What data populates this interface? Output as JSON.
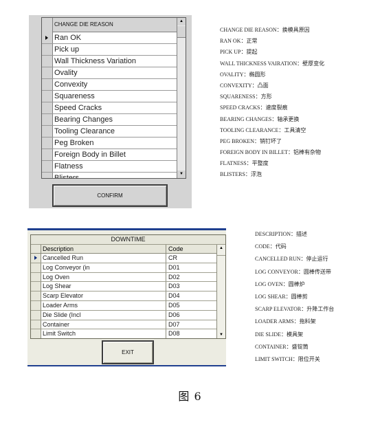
{
  "change_die_panel": {
    "column_header": "CHANGE DIE REASON",
    "selected_index": 0,
    "rows": [
      "Ran OK",
      "Pick up",
      "Wall Thickness Variation",
      "Ovality",
      "Convexity",
      "Squareness",
      "Speed Cracks",
      "Bearing Changes",
      "Tooling Clearance",
      "Peg Broken",
      "Foreign Body in Billet",
      "Flatness",
      "Blisters"
    ],
    "confirm_label": "CONFIRM",
    "scroll_up_icon": "▲",
    "scroll_down_icon": "▼"
  },
  "glossary_1": [
    "CHANGE DIE REASON：换模具原因",
    "RAN OK：正常",
    "PICK UP：提起",
    "WALL THICKNESS VAIRATION：壁厚变化",
    "OVALITY：椭圆形",
    "CONVEXITY：凸面",
    "SQUARENESS：方形",
    "SPEED CRACKS：速度裂痕",
    "BEARING CHANGES：轴承更换",
    "TOOLING CLEARANCE：工具清空",
    "PEG BROKEN：销钉坏了",
    "FOREIGN BODY IN BILLET：铝棒有杂物",
    "FLATNESS：平整度",
    "BLISTERS：浮泡"
  ],
  "downtime_panel": {
    "title": "DOWNTIME",
    "columns": [
      "Description",
      "Code"
    ],
    "selected_index": 0,
    "rows": [
      {
        "description": "Cancelled Run",
        "code": "CR"
      },
      {
        "description": "Log Conveyor (in",
        "code": "D01"
      },
      {
        "description": "Log Oven",
        "code": "D02"
      },
      {
        "description": "Log Shear",
        "code": "D03"
      },
      {
        "description": "Scarp Elevator",
        "code": "D04"
      },
      {
        "description": "Loader Arms",
        "code": "D05"
      },
      {
        "description": "Die Slide (Incl",
        "code": "D06"
      },
      {
        "description": "Container",
        "code": "D07"
      },
      {
        "description": "Limit Switch",
        "code": "D08"
      }
    ],
    "exit_label": "EXIT",
    "scroll_up_icon": "▲",
    "scroll_down_icon": "▼"
  },
  "glossary_2": [
    "DESCRIPTION：描述",
    "CODE：代码",
    "CANCELLED RUN：停止运行",
    "LOG CONVEYOR：圆棒传送带",
    "LOG OVEN：圆棒炉",
    "LOG SHEAR：圆棒剪",
    "SCARP ELEVATOR：升降工作台",
    "LOADER ARMS：拖料架",
    "DIE SLIDE：模具架",
    "CONTAINER：盛锭筒",
    "LIMIT SWITCH：限位开关"
  ],
  "caption": "图  6"
}
